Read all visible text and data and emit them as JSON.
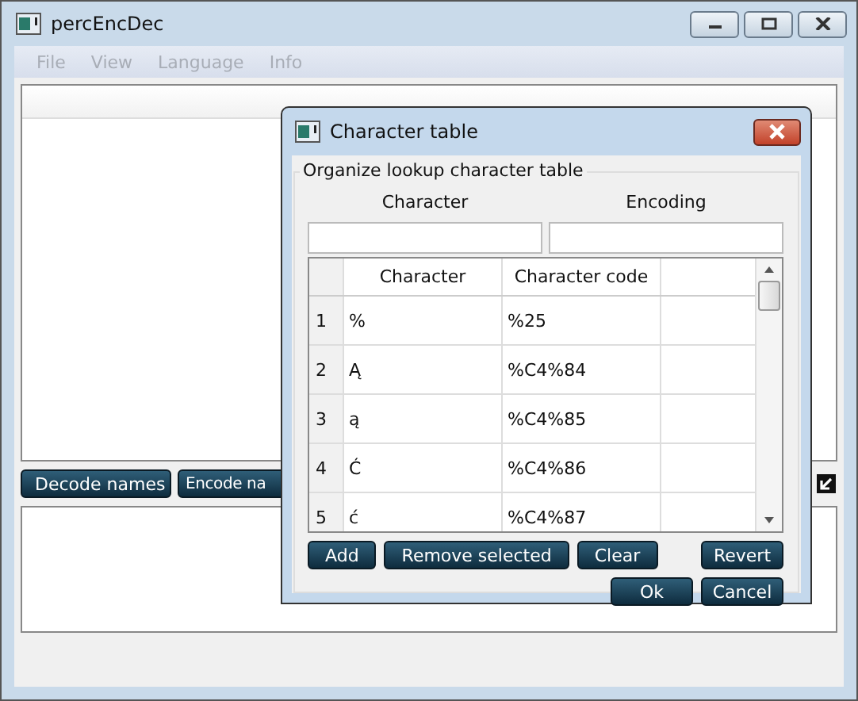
{
  "window": {
    "title": "percEncDec"
  },
  "menu": [
    {
      "label": "File",
      "disabled": true
    },
    {
      "label": "View",
      "disabled": true
    },
    {
      "label": "Language",
      "disabled": true
    },
    {
      "label": "Info",
      "disabled": true
    }
  ],
  "buttons": [
    "Decode names",
    "Encode na"
  ],
  "dialog": {
    "title": "Character table",
    "group_title": "Organize lookup character table",
    "field_labels": [
      "Character",
      "Encoding"
    ],
    "table": {
      "columns": [
        "Character",
        "Character code"
      ],
      "rows": [
        {
          "index": "1",
          "character": "%",
          "code": "%25"
        },
        {
          "index": "2",
          "character": "Ą",
          "code": "%C4%84"
        },
        {
          "index": "3",
          "character": "ą",
          "code": "%C4%85"
        },
        {
          "index": "4",
          "character": "Ć",
          "code": "%C4%86"
        },
        {
          "index": "5",
          "character": "ć",
          "code": "%C4%87"
        }
      ]
    },
    "left_buttons": [
      "Add",
      "Remove selected",
      "Clear"
    ],
    "right_buttons": [
      "Revert"
    ],
    "bottom_buttons": [
      "Ok",
      "Cancel"
    ]
  }
}
